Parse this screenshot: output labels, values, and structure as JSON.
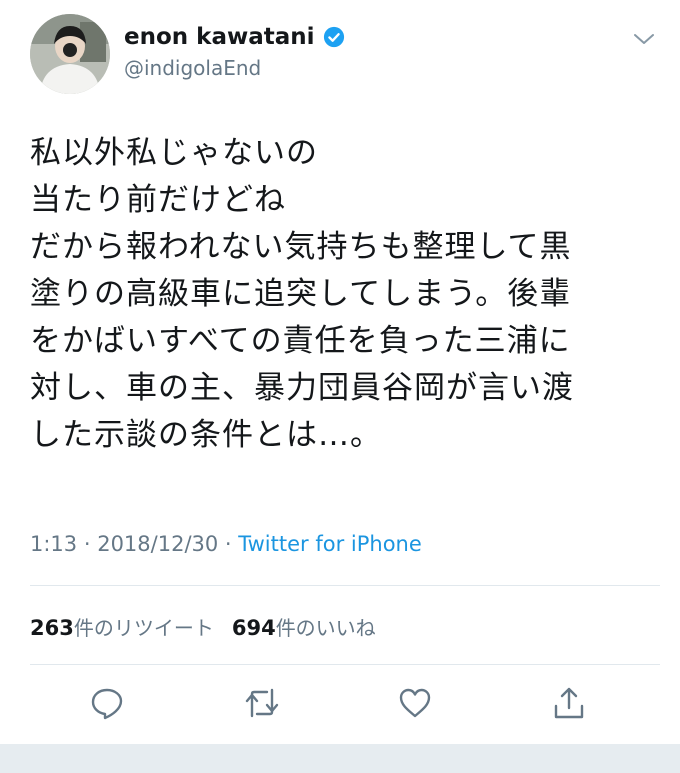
{
  "user": {
    "display_name": "enon kawatani",
    "handle": "@indigolaEnd"
  },
  "tweet": {
    "lines": [
      "私以外私じゃないの",
      "当たり前だけどね",
      "だから報われない気持ちも整理して黒",
      "塗りの高級車に追突してしまう。後輩",
      "をかばいすべての責任を負った三浦に",
      "対し、車の主、暴力団員谷岡が言い渡",
      "した示談の条件とは…。"
    ]
  },
  "meta": {
    "time": "1:13",
    "separator1": " · ",
    "date": "2018/12/30",
    "separator2": " · ",
    "via": "Twitter for iPhone"
  },
  "stats": {
    "retweet_count": "263",
    "retweet_label": "件のリツイート",
    "like_count": "694",
    "like_label": "件のいいね"
  },
  "icons": {
    "verified": "verified-badge-icon",
    "menu": "chevron-down-icon",
    "reply": "reply-icon",
    "retweet": "retweet-icon",
    "like": "heart-icon",
    "share": "share-icon"
  },
  "colors": {
    "verified": "#1da1f2",
    "link": "#1b95e0",
    "secondary_text": "#657786",
    "divider": "#e1e8ed"
  }
}
